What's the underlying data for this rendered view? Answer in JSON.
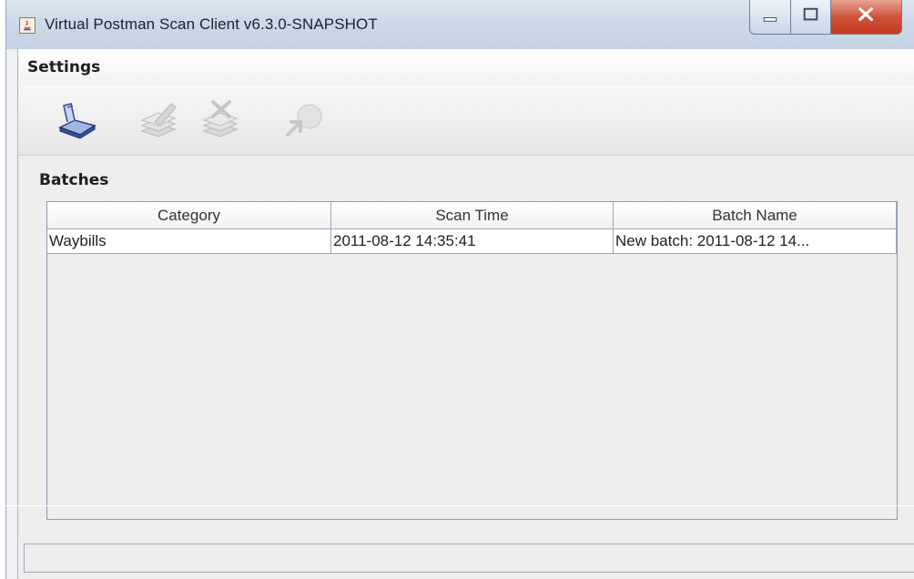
{
  "window": {
    "title": "Virtual Postman Scan Client v6.3.0-SNAPSHOT",
    "icons": [
      "java-app-icon",
      "minimize-icon",
      "maximize-icon",
      "close-icon"
    ]
  },
  "menu": {
    "items": [
      "Settings"
    ]
  },
  "toolbar": {
    "buttons": [
      {
        "name": "scan-button",
        "icon": "scanner-icon",
        "enabled": true
      },
      {
        "name": "edit-batch-button",
        "icon": "edit-stack-icon",
        "enabled": false
      },
      {
        "name": "delete-batch-button",
        "icon": "delete-stack-icon",
        "enabled": false
      },
      {
        "name": "send-button",
        "icon": "send-arrow-icon",
        "enabled": false
      }
    ]
  },
  "batches": {
    "label": "Batches",
    "columns": [
      "Category",
      "Scan Time",
      "Batch Name"
    ],
    "rows": [
      [
        "Waybills",
        "2011-08-12 14:35:41",
        "New batch: 2011-08-12 14..."
      ]
    ]
  },
  "colors": {
    "close_button": "#c43a20",
    "title_bar": "#ccd9e8",
    "grid_line": "#9ea9b8"
  }
}
